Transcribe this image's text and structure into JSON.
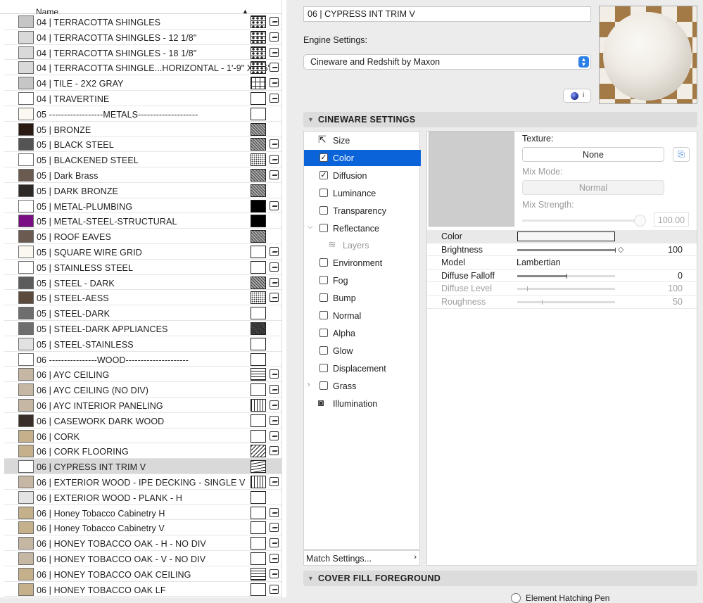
{
  "list": {
    "header": "Name",
    "sort_icon": "sort-ascending-icon",
    "rows": [
      {
        "name": "04 | TERRACOTTA SHINGLES",
        "swatch": "#c6c6c6",
        "pattern": "p-shing",
        "pic": true
      },
      {
        "name": "04 | TERRACOTTA SHINGLES - 12 1/8\"",
        "swatch": "#d9d9d9",
        "pattern": "p-shing",
        "pic": true
      },
      {
        "name": "04 | TERRACOTTA SHINGLES - 18 1/8\"",
        "swatch": "#d9d9d9",
        "pattern": "p-shing",
        "pic": true
      },
      {
        "name": "04 | TERRACOTTA SHINGLE...HORIZONTAL - 1'-9\" X 9.5\"",
        "swatch": "#d9d9d9",
        "pattern": "p-shing",
        "pic": true
      },
      {
        "name": "04 | TILE - 2X2 GRAY",
        "swatch": "#c6c6c6",
        "pattern": "p-grid",
        "pic": true
      },
      {
        "name": "04 | TRAVERTINE",
        "swatch": "#ffffff",
        "pattern": "",
        "pic": true
      },
      {
        "name": "05 ------------------METALS--------------------",
        "swatch": "#fbf8f2",
        "pattern": "",
        "pic": false
      },
      {
        "name": "05 |  BRONZE",
        "swatch": "#2a1a12",
        "pattern": "p-hatch",
        "pic": false
      },
      {
        "name": "05 | BLACK STEEL",
        "swatch": "#545454",
        "pattern": "p-hatch",
        "pic": true
      },
      {
        "name": "05 | BLACKENED STEEL",
        "swatch": "#ffffff",
        "pattern": "p-dots",
        "pic": true
      },
      {
        "name": "05 | Dark Brass",
        "swatch": "#6b5a50",
        "pattern": "p-hatch",
        "pic": true
      },
      {
        "name": "05 | DARK BRONZE",
        "swatch": "#2e2925",
        "pattern": "p-hatch",
        "pic": false
      },
      {
        "name": "05 | METAL-PLUMBING",
        "swatch": "#ffffff",
        "pattern": "p-solid",
        "pic": true
      },
      {
        "name": "05 | METAL-STEEL-STRUCTURAL",
        "swatch": "#7a0d83",
        "pattern": "p-solid",
        "pic": false
      },
      {
        "name": "05 | ROOF EAVES",
        "swatch": "#6b5a50",
        "pattern": "p-hatch",
        "pic": false
      },
      {
        "name": "05 | SQUARE WIRE GRID",
        "swatch": "#fbf8f2",
        "pattern": "",
        "pic": true
      },
      {
        "name": "05 | STAINLESS STEEL",
        "swatch": "#ffffff",
        "pattern": "",
        "pic": true
      },
      {
        "name": "05 | STEEL - DARK",
        "swatch": "#5c5c5c",
        "pattern": "p-hatch",
        "pic": true
      },
      {
        "name": "05 | STEEL-AESS",
        "swatch": "#5b4a3c",
        "pattern": "p-dots",
        "pic": true
      },
      {
        "name": "05 | STEEL-DARK",
        "swatch": "#6e6e6e",
        "pattern": "",
        "pic": false
      },
      {
        "name": "05 | STEEL-DARK APPLIANCES",
        "swatch": "#6e6e6e",
        "pattern": "p-dense",
        "pic": false
      },
      {
        "name": "05 | STEEL-STAINLESS",
        "swatch": "#e1e1e1",
        "pattern": "",
        "pic": false
      },
      {
        "name": "06 ----------------WOOD---------------------",
        "swatch": "#ffffff",
        "pattern": "",
        "pic": false
      },
      {
        "name": "06 | AYC CEILING",
        "swatch": "#c6b7a4",
        "pattern": "p-hlines",
        "pic": true
      },
      {
        "name": "06 | AYC CEILING (NO DIV)",
        "swatch": "#c6b7a4",
        "pattern": "",
        "pic": true
      },
      {
        "name": "06 | AYC INTERIOR PANELING",
        "swatch": "#c6b7a4",
        "pattern": "p-vlines",
        "pic": true
      },
      {
        "name": "06 | CASEWORK DARK WOOD",
        "swatch": "#3a2f28",
        "pattern": "",
        "pic": true
      },
      {
        "name": "06 | CORK",
        "swatch": "#c4b08a",
        "pattern": "",
        "pic": true
      },
      {
        "name": "06 | CORK FLOORING",
        "swatch": "#c4b08a",
        "pattern": "p-diag",
        "pic": true
      },
      {
        "name": "06 | CYPRESS INT TRIM V",
        "swatch": "#ffffff",
        "pattern": "p-wave",
        "pic": false,
        "selected": true
      },
      {
        "name": "06 | EXTERIOR WOOD - IPE DECKING - SINGLE V",
        "swatch": "#c6b7a4",
        "pattern": "p-vlines",
        "pic": true
      },
      {
        "name": "06 | EXTERIOR WOOD - PLANK - H",
        "swatch": "#e4e4e4",
        "pattern": "",
        "pic": false
      },
      {
        "name": "06 | Honey Tobacco Cabinetry H",
        "swatch": "#c4b08a",
        "pattern": "",
        "pic": true
      },
      {
        "name": "06 | Honey Tobacco Cabinetry V",
        "swatch": "#c4b08a",
        "pattern": "",
        "pic": true
      },
      {
        "name": "06 | HONEY TOBACCO OAK - H -  NO DIV",
        "swatch": "#c6b7a4",
        "pattern": "",
        "pic": true
      },
      {
        "name": "06 | HONEY TOBACCO OAK - V -  NO DIV",
        "swatch": "#c6b7a4",
        "pattern": "",
        "pic": true
      },
      {
        "name": "06 | HONEY TOBACCO OAK CEILING",
        "swatch": "#c4b08a",
        "pattern": "p-hlines",
        "pic": true
      },
      {
        "name": "06 | HONEY TOBACCO OAK LF",
        "swatch": "#c4b08a",
        "pattern": "",
        "pic": true
      }
    ]
  },
  "material": {
    "name": "06 | CYPRESS INT TRIM V",
    "engine_label": "Engine Settings:",
    "engine_value": "Cineware and Redshift by Maxon",
    "engine_arrows": "▲▼",
    "info_label": "i",
    "preview_icon": "sphere-preview-icon"
  },
  "sections": {
    "cineware": "CINEWARE SETTINGS",
    "cover_fill": "COVER FILL FOREGROUND",
    "collapse_icon": "▼"
  },
  "channels": [
    {
      "label": "Size",
      "kind": "icon",
      "icon": "⇱"
    },
    {
      "label": "Color",
      "kind": "check",
      "checked": true,
      "selected": true
    },
    {
      "label": "Diffusion",
      "kind": "check",
      "checked": true
    },
    {
      "label": "Luminance",
      "kind": "check",
      "checked": false
    },
    {
      "label": "Transparency",
      "kind": "check",
      "checked": false
    },
    {
      "label": "Reflectance",
      "kind": "check",
      "checked": false,
      "expand": "⌵"
    },
    {
      "label": "Layers",
      "kind": "sub",
      "icon": "≋"
    },
    {
      "label": "Environment",
      "kind": "check",
      "checked": false
    },
    {
      "label": "Fog",
      "kind": "check",
      "checked": false
    },
    {
      "label": "Bump",
      "kind": "check",
      "checked": false
    },
    {
      "label": "Normal",
      "kind": "check",
      "checked": false
    },
    {
      "label": "Alpha",
      "kind": "check",
      "checked": false
    },
    {
      "label": "Glow",
      "kind": "check",
      "checked": false
    },
    {
      "label": "Displacement",
      "kind": "check",
      "checked": false
    },
    {
      "label": "Grass",
      "kind": "check",
      "checked": false,
      "expand": "›"
    },
    {
      "label": "Illumination",
      "kind": "icon",
      "icon": "◙"
    }
  ],
  "match_settings": "Match Settings...",
  "color_panel": {
    "texture_label": "Texture:",
    "texture_value": "None",
    "mix_mode_label": "Mix Mode:",
    "mix_mode_value": "Normal",
    "mix_strength_label": "Mix Strength:",
    "mix_strength_value": "100.00",
    "swatch_color": "#cdcdcd"
  },
  "properties": [
    {
      "label": "Color",
      "type": "color"
    },
    {
      "label": "Brightness",
      "type": "slider",
      "value": "100",
      "fill": 1.0,
      "diamond": true
    },
    {
      "label": "Model",
      "type": "text",
      "text": "Lambertian"
    },
    {
      "label": "Diffuse Falloff",
      "type": "slider",
      "value": "0",
      "fill": 0.5
    },
    {
      "label": "Diffuse Level",
      "type": "slider",
      "value": "100",
      "fill": 0.1,
      "disabled": true
    },
    {
      "label": "Roughness",
      "type": "slider",
      "value": "50",
      "fill": 0.25,
      "disabled": true
    }
  ],
  "cover_fill": {
    "option_text": "Element Hatching Pen"
  }
}
